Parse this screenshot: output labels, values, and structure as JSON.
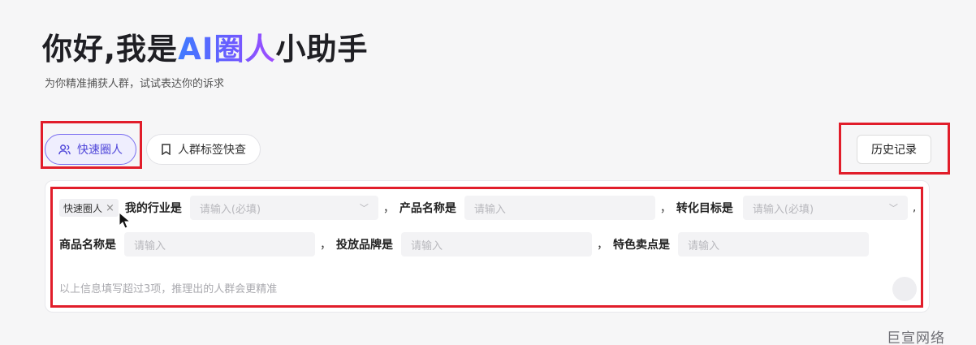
{
  "header": {
    "title_prefix": "你好,我是",
    "title_highlight": "AI圈人",
    "title_suffix": "小助手",
    "subtitle": "为你精准捕获人群，试试表达你的诉求"
  },
  "tabs": [
    {
      "label": "快速圈人",
      "icon": "users-icon",
      "active": true
    },
    {
      "label": "人群标签快查",
      "icon": "bookmark-icon",
      "active": false
    }
  ],
  "history_button": "历史记录",
  "form": {
    "chip_label": "快速圈人",
    "chip_close": "×",
    "comma": "，",
    "comma_end": ",",
    "fields": {
      "industry": {
        "label": "我的行业是",
        "placeholder": "请输入(必填)"
      },
      "product": {
        "label": "产品名称是",
        "placeholder": "请输入"
      },
      "goal": {
        "label": "转化目标是",
        "placeholder": "请输入(必填)"
      },
      "goods": {
        "label": "商品名称是",
        "placeholder": "请输入"
      },
      "brand": {
        "label": "投放品牌是",
        "placeholder": "请输入"
      },
      "selling_point": {
        "label": "特色卖点是",
        "placeholder": "请输入"
      }
    },
    "hint": "以上信息填写超过3项，推理出的人群会更精准"
  },
  "watermark": "巨宣网络",
  "colors": {
    "accent": "#6a5cff",
    "highlight_box": "#e11d2a"
  }
}
